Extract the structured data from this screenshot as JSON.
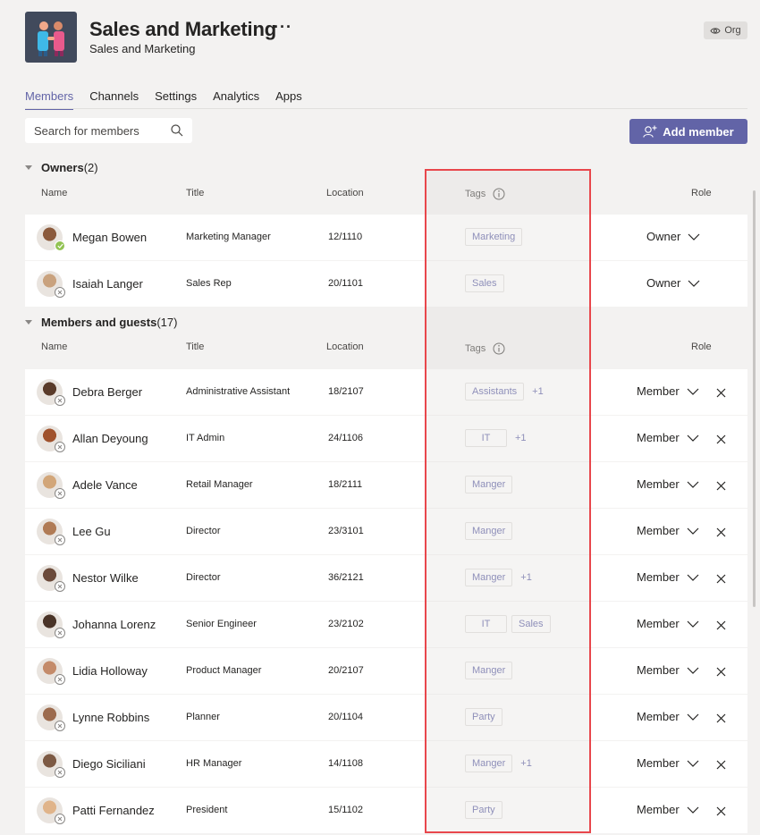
{
  "header": {
    "team_name": "Sales and Marketing",
    "more": "···",
    "subtitle": "Sales and Marketing",
    "org_label": "Org"
  },
  "tabs": [
    {
      "label": "Members",
      "active": true
    },
    {
      "label": "Channels"
    },
    {
      "label": "Settings"
    },
    {
      "label": "Analytics"
    },
    {
      "label": "Apps"
    }
  ],
  "search": {
    "placeholder": "Search for members"
  },
  "add_button": {
    "label": "Add member"
  },
  "columns": {
    "name": "Name",
    "title": "Title",
    "location": "Location",
    "tags": "Tags",
    "role": "Role"
  },
  "owners": {
    "label": "Owners",
    "count": "(2)",
    "rows": [
      {
        "name": "Megan Bowen",
        "title": "Marketing Manager",
        "location": "12/1110",
        "tags": [
          "Marketing"
        ],
        "more": "",
        "role": "Owner",
        "status": "online"
      },
      {
        "name": "Isaiah Langer",
        "title": "Sales Rep",
        "location": "20/1101",
        "tags": [
          "Sales"
        ],
        "more": "",
        "role": "Owner",
        "status": "offline"
      }
    ]
  },
  "members": {
    "label": "Members and guests",
    "count": "(17)",
    "rows": [
      {
        "name": "Debra Berger",
        "title": "Administrative Assistant",
        "location": "18/2107",
        "tags": [
          "Assistants"
        ],
        "more": "+1",
        "role": "Member"
      },
      {
        "name": "Allan Deyoung",
        "title": "IT Admin",
        "location": "24/1106",
        "tags": [
          "IT"
        ],
        "more": "+1",
        "role": "Member"
      },
      {
        "name": "Adele Vance",
        "title": "Retail Manager",
        "location": "18/2111",
        "tags": [
          "Manger"
        ],
        "more": "",
        "role": "Member"
      },
      {
        "name": "Lee Gu",
        "title": "Director",
        "location": "23/3101",
        "tags": [
          "Manger"
        ],
        "more": "",
        "role": "Member"
      },
      {
        "name": "Nestor Wilke",
        "title": "Director",
        "location": "36/2121",
        "tags": [
          "Manger"
        ],
        "more": "+1",
        "role": "Member"
      },
      {
        "name": "Johanna Lorenz",
        "title": "Senior Engineer",
        "location": "23/2102",
        "tags": [
          "IT",
          "Sales"
        ],
        "more": "",
        "role": "Member"
      },
      {
        "name": "Lidia Holloway",
        "title": "Product Manager",
        "location": "20/2107",
        "tags": [
          "Manger"
        ],
        "more": "",
        "role": "Member"
      },
      {
        "name": "Lynne Robbins",
        "title": "Planner",
        "location": "20/1104",
        "tags": [
          "Party"
        ],
        "more": "",
        "role": "Member"
      },
      {
        "name": "Diego Siciliani",
        "title": "HR Manager",
        "location": "14/1108",
        "tags": [
          "Manger"
        ],
        "more": "+1",
        "role": "Member"
      },
      {
        "name": "Patti Fernandez",
        "title": "President",
        "location": "15/1102",
        "tags": [
          "Party"
        ],
        "more": "",
        "role": "Member"
      }
    ]
  },
  "colors": {
    "accent": "#6264a7",
    "highlight": "#e8474c",
    "online": "#92c353"
  }
}
